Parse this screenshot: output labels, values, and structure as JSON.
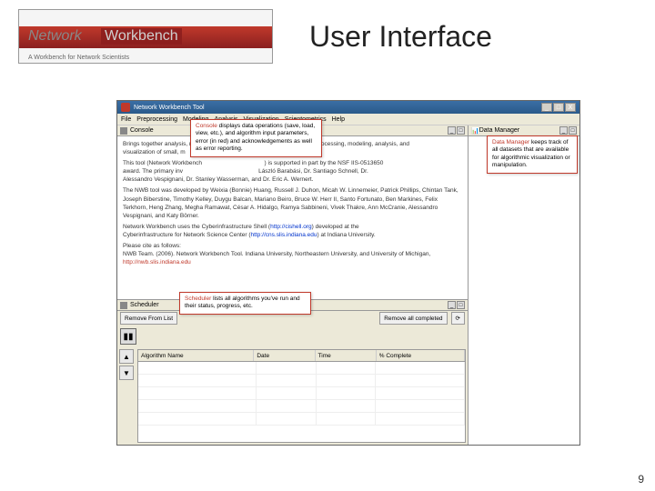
{
  "slide": {
    "logo_main": "Network",
    "logo_second": "Workbench",
    "logo_sub": "A Workbench for Network Scientists",
    "title": "User Interface",
    "page_number": "9"
  },
  "window": {
    "title": "Network Workbench Tool",
    "min": "_",
    "max": "□",
    "close": "X"
  },
  "menu": {
    "file": "File",
    "preprocessing": "Preprocessing",
    "modeling": "Modeling",
    "analysis": "Analysis",
    "visualization": "Visualization",
    "scientometrics": "Scientometrics",
    "help": "Help"
  },
  "console": {
    "header": "Console",
    "p1a": "Brings together analysis, modeling, and",
    "p1b": "visualization of small, m",
    "p2a": "This tool (Network Workbench",
    "p2b": " is supported in part by the NSF IIS-0513650",
    "p2c": "award. The primary inv",
    "p2d": "László Barabási, Dr. Santiago Schnell, Dr.",
    "p2e": "Alessandro Vespignani, Dr. Stanley Wasserman, and Dr. Eric A. Wernert.",
    "p3": "The NWB tool was developed by Weixia (Bonnie) Huang, Russell J. Duhon, Micah W. Linnemeier, Patrick Phillips, Chintan Tank, Joseph Biberstine, Timothy Kelley, Duygu Balcan, Mariano Beiro, Bruce W. Herr II, Santo Fortunato, Ben Markines, Felix Terkhorn, Heng Zhang, Megha Ramawat, César A. Hidalgo, Ramya Sabbineni, Vivek Thakre, Ann McCranie, Alessandro Vespignani, and Katy Börner.",
    "p4a": "Network Workbench uses the Cyberinfrastructure Shell (",
    "p4b": "http://cishell.org",
    "p4c": ") developed at the",
    "p4d": "Cyberinfrastructure for Network Science Center (",
    "p4e": "http://cns.slis.indiana.edu",
    "p4f": ") at Indiana University.",
    "p5a": "Please cite as follows:",
    "p5b": "NWB Team. (2006). Network Workbench Tool. Indiana University, Northeastern University, and University of Michigan, ",
    "p5c": "http://nwb.slis.indiana.edu"
  },
  "scheduler": {
    "header": "Scheduler",
    "remove_from_list": "Remove From List",
    "remove_completed": "Remove all completed",
    "pause": "▮▮"
  },
  "table": {
    "col_algorithm": "Algorithm Name",
    "col_date": "Date",
    "col_time": "Time",
    "col_complete": "% Complete"
  },
  "data_manager": {
    "header": "Data Manager",
    "icon": "📊"
  },
  "callouts": {
    "console": {
      "title": "Console",
      "body": " displays data operations (save, load, view, etc.), and algorithm input parameters, error (in red) and acknowledgements as well as error reporting."
    },
    "scheduler": {
      "title": "Scheduler",
      "body": " lists all algorithms you've run and their status, progress, etc."
    },
    "data_manager": {
      "title": "Data Manager",
      "body": " keeps track of all datasets that are available for algorithmic visualization or manipulation."
    }
  }
}
